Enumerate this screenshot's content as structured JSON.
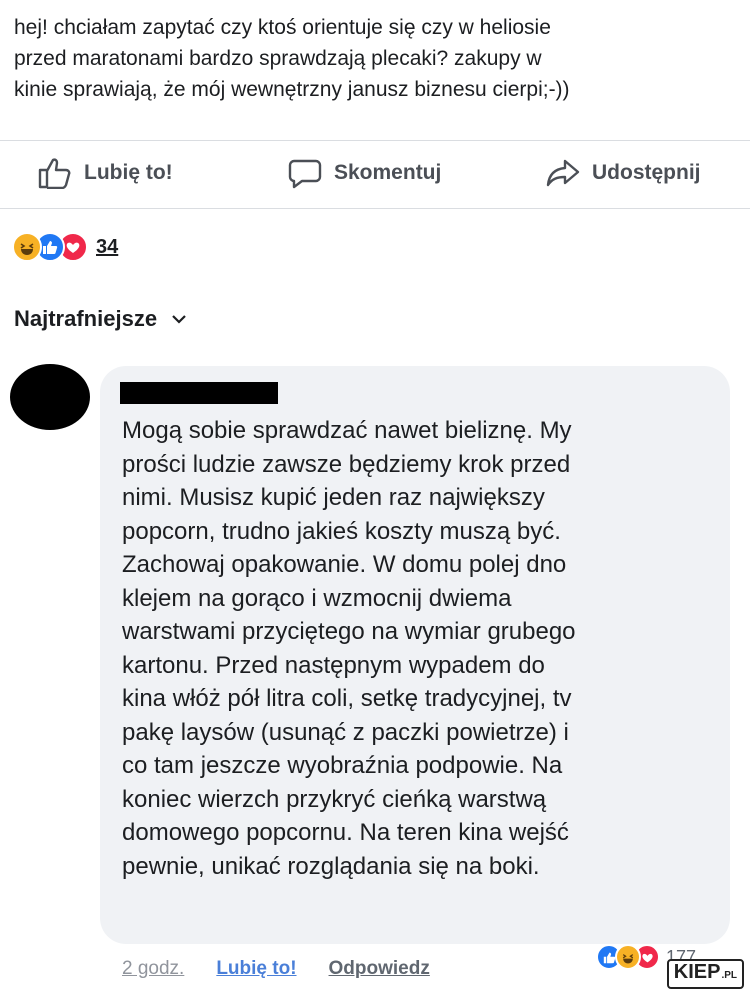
{
  "post": {
    "lines": [
      "hej! chciałam zapytać czy ktoś orientuje się czy w heliosie",
      "przed maratonami bardzo sprawdzają plecaki? zakupy w",
      "kinie sprawiają, że mój wewnętrzny janusz biznesu cierpi;-))"
    ]
  },
  "actions": {
    "like_label": "Lubię to!",
    "comment_label": "Skomentuj",
    "share_label": "Udostępnij"
  },
  "reactions": {
    "icons": [
      "haha-icon",
      "like-icon",
      "love-icon"
    ],
    "count": "34"
  },
  "comments_sort": {
    "label": "Najtrafniejsze"
  },
  "comment": {
    "lines": [
      "Mogą sobie sprawdzać nawet bieliznę. My",
      "prości ludzie zawsze będziemy krok przed",
      "nimi. Musisz kupić jeden raz największy",
      "popcorn, trudno jakieś koszty muszą być.",
      "Zachowaj opakowanie. W domu polej dno",
      "klejem na gorąco i wzmocnij dwiema",
      "warstwami przyciętego na wymiar grubego",
      "kartonu. Przed następnym wypadem do",
      "kina włóż pół litra coli, setkę tradycyjnej, tv",
      "pakę laysów (usunąć z paczki powietrze) i",
      "co tam jeszcze wyobraźnia podpowie. Na",
      "koniec wierzch przykryć cieńką warstwą",
      "domowego popcornu. Na teren kina wejść",
      "pewnie, unikać rozglądania się na boki."
    ],
    "time": "2 godz.",
    "like_label": "Lubię to!",
    "reply_label": "Odpowiedz",
    "reaction_count": "177"
  },
  "watermark": {
    "text": "KIEP",
    "suffix": ".PL"
  },
  "colors": {
    "like_blue": "#2078f4",
    "haha_yellow": "#f7b125",
    "love_red": "#f0284a",
    "bubble_bg": "#f0f2f5"
  }
}
